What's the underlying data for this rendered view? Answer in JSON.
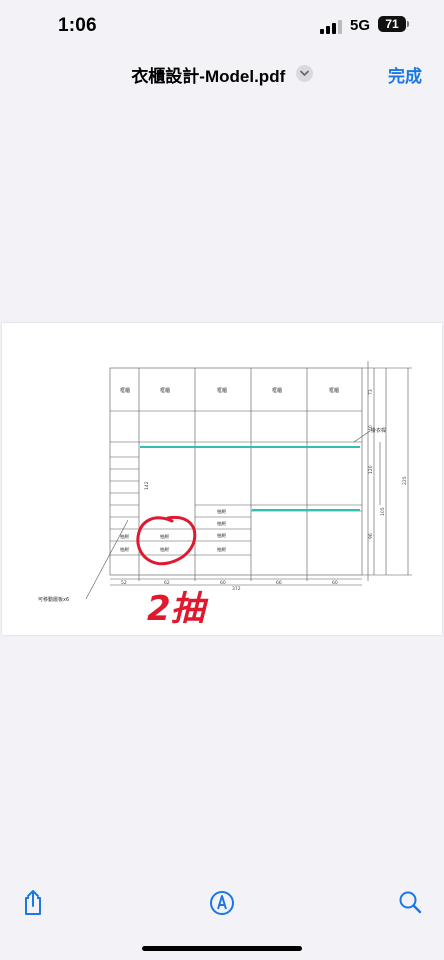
{
  "status_bar": {
    "time": "1:06",
    "network": "5G",
    "battery": "71"
  },
  "navbar": {
    "title": "衣櫃設計-Model.pdf",
    "done_label": "完成"
  },
  "document": {
    "cabinet_labels": [
      "框櫃",
      "框櫃",
      "框櫃",
      "框櫃",
      "框櫃"
    ],
    "drawer_label": "抽屜",
    "rail_label": "掛衣桿",
    "shelf_note": "可移動層板x6",
    "dimensions_bottom": [
      "52",
      "62",
      "60",
      "66",
      "60"
    ],
    "total_width": "372",
    "dim_142": "142",
    "dim_120": "120",
    "dim_105": "105",
    "dim_96": "96",
    "dim_73": "73",
    "dim_40": "40",
    "dim_225": "225",
    "handwriting": "2抽"
  },
  "toolbar": {
    "share": "share-icon",
    "markup": "markup-icon",
    "search": "search-icon"
  },
  "colors": {
    "accent": "#1a78e6",
    "annotation_red": "#e0192e",
    "rail_teal": "#2fbfb3"
  }
}
